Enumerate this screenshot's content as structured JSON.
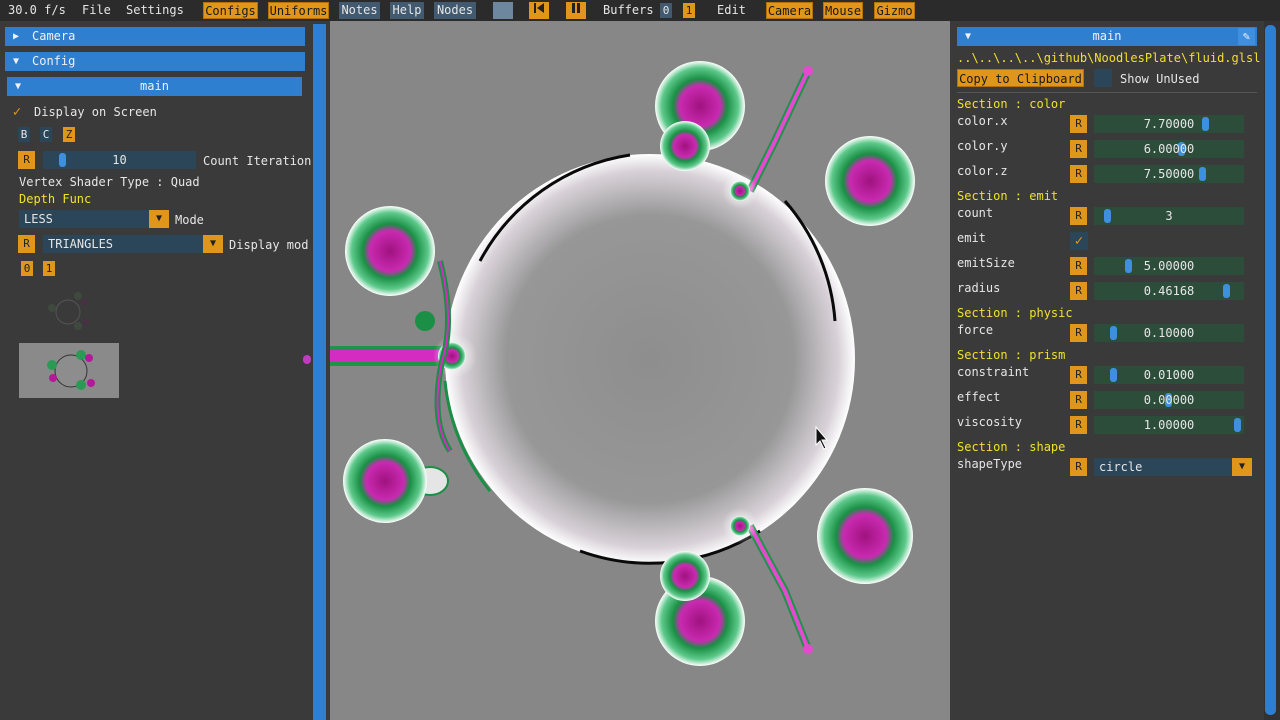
{
  "menubar": {
    "fps": "30.0 f/s",
    "file": "File",
    "settings": "Settings",
    "configs": "Configs",
    "uniforms": "Uniforms",
    "notes": "Notes",
    "help": "Help",
    "nodes": "Nodes",
    "buffers": "Buffers",
    "buf0": "0",
    "buf1": "1",
    "edit": "Edit",
    "camera": "Camera",
    "mouse": "Mouse",
    "gizmo": "Gizmo"
  },
  "left": {
    "camera_header": "Camera",
    "config_header": "Config",
    "main_header": "main",
    "display_on_screen": "Display on Screen",
    "btn_b": "B",
    "btn_c": "C",
    "btn_z": "Z",
    "r": "R",
    "count_iteration_value": "10",
    "count_iteration_label": "Count Iteration",
    "vertex_shader_type": "Vertex Shader Type : Quad",
    "depth_func": "Depth Func",
    "mode_value": "LESS",
    "mode_label": "Mode",
    "display_mode_value": "TRIANGLES",
    "display_mode_label": "Display mod",
    "buf0": "0",
    "buf1": "1"
  },
  "right": {
    "header": "main",
    "path": "..\\..\\..\\..\\github\\NoodlesPlate\\fluid.glsl",
    "copy_button": "Copy to Clipboard",
    "show_unused": "Show UnUsed",
    "r": "R",
    "sections": {
      "color": "Section : color",
      "emit": "Section : emit",
      "physic": "Section : physic",
      "prism": "Section : prism",
      "shape": "Section : shape"
    },
    "uniforms": {
      "color_x": {
        "label": "color.x",
        "value": "7.70000"
      },
      "color_y": {
        "label": "color.y",
        "value": "6.00000"
      },
      "color_z": {
        "label": "color.z",
        "value": "7.50000"
      },
      "count": {
        "label": "count",
        "value": "3"
      },
      "emit": {
        "label": "emit"
      },
      "emitSize": {
        "label": "emitSize",
        "value": "5.00000"
      },
      "radius": {
        "label": "radius",
        "value": "0.46168"
      },
      "force": {
        "label": "force",
        "value": "0.10000"
      },
      "constraint": {
        "label": "constraint",
        "value": "0.01000"
      },
      "effect": {
        "label": "effect",
        "value": "0.00000"
      },
      "viscosity": {
        "label": "viscosity",
        "value": "1.00000"
      },
      "shapeType": {
        "label": "shapeType",
        "value": "circle"
      }
    }
  },
  "colors": {
    "accent_orange": "#e0961b",
    "header_blue": "#2f7fd1",
    "section_yellow": "#f2e02a",
    "magenta": "#c2169f",
    "green": "#1b8f45"
  }
}
